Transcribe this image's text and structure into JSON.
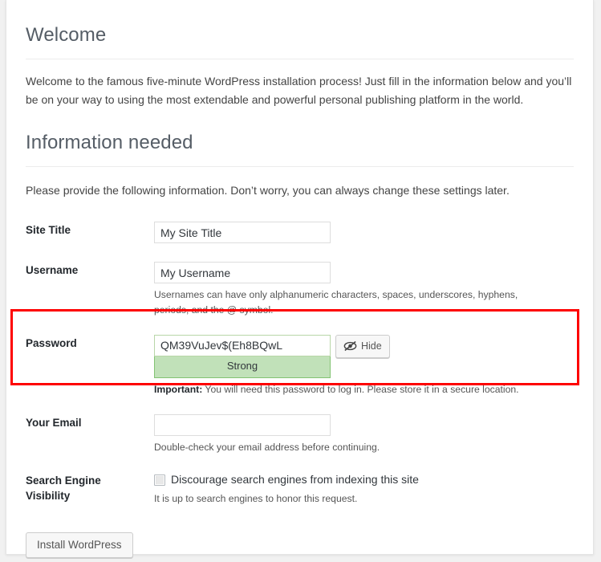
{
  "welcome": {
    "heading": "Welcome",
    "intro": "Welcome to the famous five-minute WordPress installation process! Just fill in the information below and you’ll be on your way to using the most extendable and powerful personal publishing platform in the world."
  },
  "info": {
    "heading": "Information needed",
    "intro": "Please provide the following information. Don’t worry, you can always change these settings later."
  },
  "fields": {
    "site_title": {
      "label": "Site Title",
      "value": "My Site Title",
      "placeholder": ""
    },
    "username": {
      "label": "Username",
      "value": "My Username",
      "placeholder": "",
      "description": "Usernames can have only alphanumeric characters, spaces, underscores, hyphens, periods, and the @ symbol."
    },
    "password": {
      "label": "Password",
      "value": "QM39VuJev$(Eh8BQwL",
      "placeholder": "",
      "hide_button_label": "Hide",
      "hide_button_icon": "eye-slash-icon",
      "strength_label": "Strong",
      "strength_level": "strong",
      "strength_bg_color": "#c1e1b9",
      "strength_border_color": "#83c373",
      "description_bold": "Important:",
      "description": " You will need this password to log in. Please store it in a secure location."
    },
    "email": {
      "label": "Your Email",
      "value": "",
      "placeholder": "",
      "description": "Double-check your email address before continuing."
    },
    "search_visibility": {
      "label": "Search Engine Visibility",
      "checkbox_label": "Discourage search engines from indexing this site",
      "checked": false,
      "description": "It is up to search engines to honor this request."
    }
  },
  "submit": {
    "label": "Install WordPress"
  },
  "annotation": {
    "highlight_color": "#fe0000",
    "target": "password-field-row"
  }
}
